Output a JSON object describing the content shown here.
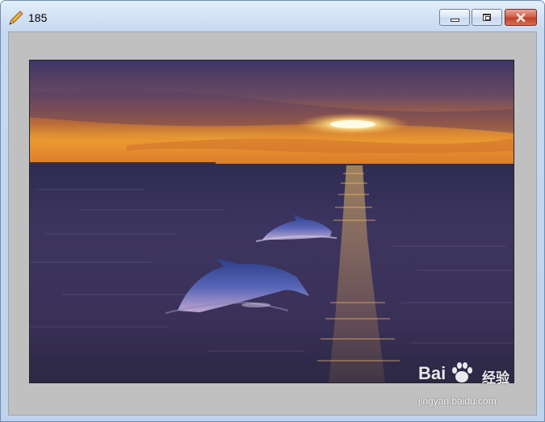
{
  "window": {
    "title": "185",
    "icon": "pencil-icon",
    "controls": {
      "minimize": "minimize-icon",
      "maximize": "maximize-icon",
      "close": "close-icon"
    }
  },
  "image": {
    "subject": "two dolphins leaping in the sea at sunset",
    "colors": {
      "sky_top": "#4a3a6a",
      "horizon": "#f0a030",
      "sun": "#fff2b0",
      "water": "#3a3358"
    }
  },
  "watermark": {
    "brand": "Bai",
    "brand_suffix": "经验",
    "url": "jingyan.baidu.com"
  }
}
